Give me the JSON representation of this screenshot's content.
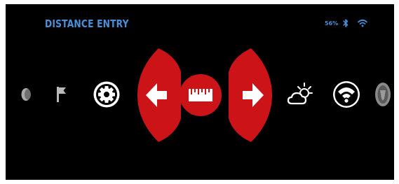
{
  "header": {
    "title": "DISTANCE ENTRY",
    "battery_text": "56%",
    "icons": [
      "bluetooth-icon",
      "wifi-status-icon"
    ]
  },
  "menu": {
    "items": [
      {
        "icon": "moon-icon",
        "selected": false
      },
      {
        "icon": "flag-icon",
        "selected": false
      },
      {
        "icon": "gear-icon",
        "selected": false
      },
      {
        "icon": "left-arrow-icon",
        "selected": false
      },
      {
        "icon": "ruler-icon",
        "selected": true
      },
      {
        "icon": "right-arrow-icon",
        "selected": false
      },
      {
        "icon": "weather-icon",
        "selected": false
      },
      {
        "icon": "wifi-icon",
        "selected": false
      },
      {
        "icon": "shield-icon",
        "selected": false
      }
    ]
  },
  "colors": {
    "background": "#000000",
    "title_blue": "#4a90d9",
    "highlight_red": "#cc1418",
    "icon_white": "#ffffff",
    "icon_grey": "#9a9a9a"
  }
}
